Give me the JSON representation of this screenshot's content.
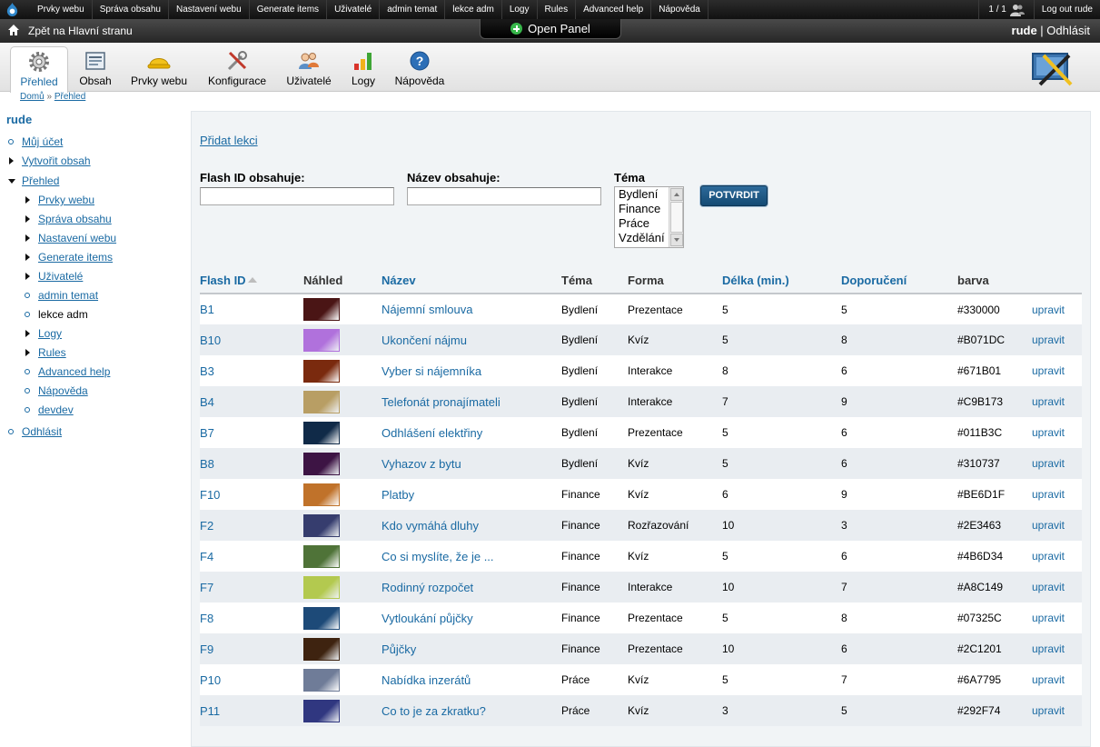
{
  "admin_menu": {
    "items": [
      "Prvky webu",
      "Správa obsahu",
      "Nastavení webu",
      "Generate items",
      "Uživatelé",
      "admin temat",
      "lekce adm",
      "Logy",
      "Rules",
      "Advanced help",
      "Nápověda"
    ],
    "user_count": "1 / 1",
    "logout": "Log out rude"
  },
  "top_bar": {
    "back_link": "Zpět na Hlavní stranu",
    "open_panel": "Open Panel",
    "username": "rude",
    "separator": " | ",
    "logout": "Odhlásit"
  },
  "tabs": [
    {
      "label": "Přehled",
      "icon": "gear-icon",
      "active": true
    },
    {
      "label": "Obsah",
      "icon": "document-icon"
    },
    {
      "label": "Prvky webu",
      "icon": "hardhat-icon"
    },
    {
      "label": "Konfigurace",
      "icon": "tools-icon"
    },
    {
      "label": "Uživatelé",
      "icon": "users-icon"
    },
    {
      "label": "Logy",
      "icon": "bar-chart-icon"
    },
    {
      "label": "Nápověda",
      "icon": "help-icon"
    }
  ],
  "breadcrumb": {
    "home": "Domů",
    "sep": " » ",
    "current": "Přehled"
  },
  "sidebar": {
    "username": "rude",
    "items": [
      {
        "label": "Můj účet",
        "bullet": "circle"
      },
      {
        "label": "Vytvořit obsah",
        "bullet": "triangle"
      },
      {
        "label": "Přehled",
        "bullet": "triangle-down"
      }
    ],
    "subitems": [
      {
        "label": "Prvky webu",
        "bullet": "triangle"
      },
      {
        "label": "Správa obsahu",
        "bullet": "triangle"
      },
      {
        "label": "Nastavení webu",
        "bullet": "triangle"
      },
      {
        "label": "Generate items",
        "bullet": "triangle"
      },
      {
        "label": "Uživatelé",
        "bullet": "triangle"
      },
      {
        "label": "admin temat",
        "bullet": "circle"
      },
      {
        "label": "lekce adm",
        "bullet": "circle",
        "plain": true
      },
      {
        "label": "Logy",
        "bullet": "triangle"
      },
      {
        "label": "Rules",
        "bullet": "triangle"
      },
      {
        "label": "Advanced help",
        "bullet": "circle"
      },
      {
        "label": "Nápověda",
        "bullet": "circle"
      },
      {
        "label": "devdev",
        "bullet": "circle"
      }
    ],
    "logout": "Odhlásit"
  },
  "content": {
    "add_link": "Přidat lekci",
    "filter": {
      "flash_label": "Flash ID obsahuje:",
      "flash_value": "",
      "name_label": "Název obsahuje:",
      "name_value": "",
      "topic_label": "Téma",
      "topic_options": [
        "Bydlení",
        "Finance",
        "Práce",
        "Vzdělání"
      ],
      "submit": "POTVRDIT"
    },
    "table": {
      "headers": [
        "Flash ID",
        "Náhled",
        "Název",
        "Téma",
        "Forma",
        "Délka (min.)",
        "Doporučení",
        "barva",
        ""
      ],
      "edit_label": "upravit",
      "rows": [
        {
          "id": "B1",
          "name": "Nájemní smlouva",
          "topic": "Bydlení",
          "form": "Prezentace",
          "length": "5",
          "rec": "5",
          "color": "#330000",
          "thumb": "#4a1515"
        },
        {
          "id": "B10",
          "name": "Ukončení nájmu",
          "topic": "Bydlení",
          "form": "Kvíz",
          "length": "5",
          "rec": "8",
          "color": "#B071DC",
          "thumb": "#b071dc"
        },
        {
          "id": "B3",
          "name": "Vyber si nájemníka",
          "topic": "Bydlení",
          "form": "Interakce",
          "length": "8",
          "rec": "6",
          "color": "#671B01",
          "thumb": "#7a2a0e"
        },
        {
          "id": "B4",
          "name": "Telefonát pronajímateli",
          "topic": "Bydlení",
          "form": "Interakce",
          "length": "7",
          "rec": "9",
          "color": "#C9B173",
          "thumb": "#b89e64"
        },
        {
          "id": "B7",
          "name": "Odhlášení elektřiny",
          "topic": "Bydlení",
          "form": "Prezentace",
          "length": "5",
          "rec": "6",
          "color": "#011B3C",
          "thumb": "#102a48"
        },
        {
          "id": "B8",
          "name": "Vyhazov z bytu",
          "topic": "Bydlení",
          "form": "Kvíz",
          "length": "5",
          "rec": "6",
          "color": "#310737",
          "thumb": "#3d1444"
        },
        {
          "id": "F10",
          "name": "Platby",
          "topic": "Finance",
          "form": "Kvíz",
          "length": "6",
          "rec": "9",
          "color": "#BE6D1F",
          "thumb": "#c0722a"
        },
        {
          "id": "F2",
          "name": "Kdo vymáhá dluhy",
          "topic": "Finance",
          "form": "Rozřazování",
          "length": "10",
          "rec": "3",
          "color": "#2E3463",
          "thumb": "#363d6e"
        },
        {
          "id": "F4",
          "name": "Co si myslíte, že je ...",
          "topic": "Finance",
          "form": "Kvíz",
          "length": "5",
          "rec": "6",
          "color": "#4B6D34",
          "thumb": "#4f7338"
        },
        {
          "id": "F7",
          "name": "Rodinný rozpočet",
          "topic": "Finance",
          "form": "Interakce",
          "length": "10",
          "rec": "7",
          "color": "#A8C149",
          "thumb": "#b3c94f"
        },
        {
          "id": "F8",
          "name": "Vytloukání půjčky",
          "topic": "Finance",
          "form": "Prezentace",
          "length": "5",
          "rec": "8",
          "color": "#07325C",
          "thumb": "#1d4a78"
        },
        {
          "id": "F9",
          "name": "Půjčky",
          "topic": "Finance",
          "form": "Prezentace",
          "length": "10",
          "rec": "6",
          "color": "#2C1201",
          "thumb": "#3e2310"
        },
        {
          "id": "P10",
          "name": "Nabídka inzerátů",
          "topic": "Práce",
          "form": "Kvíz",
          "length": "5",
          "rec": "7",
          "color": "#6A7795",
          "thumb": "#6f7c98"
        },
        {
          "id": "P11",
          "name": "Co to je za zkratku?",
          "topic": "Práce",
          "form": "Kvíz",
          "length": "3",
          "rec": "5",
          "color": "#292F74",
          "thumb": "#303780"
        }
      ]
    }
  }
}
